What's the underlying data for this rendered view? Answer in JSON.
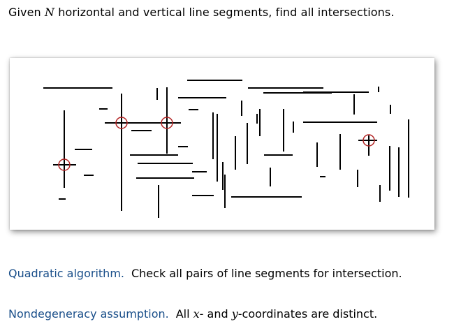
{
  "title": {
    "prefix": "Given",
    "var": "N",
    "suffix": "horizontal and vertical line segments, find all intersections."
  },
  "points": [
    {
      "term": "Quadratic algorithm.",
      "text_parts": [
        {
          "t": "Check all pairs of line segments for intersection.",
          "var": false
        }
      ]
    },
    {
      "term": "Nondegeneracy assumption.",
      "text_parts": [
        {
          "t": "All ",
          "var": false
        },
        {
          "t": "x",
          "var": true
        },
        {
          "t": "- and ",
          "var": false
        },
        {
          "t": "y",
          "var": true
        },
        {
          "t": "-coordinates are distinct.",
          "var": false
        }
      ]
    }
  ],
  "colors": {
    "segment": "#000000",
    "intersection_marker": "#b22222",
    "term": "#1a4f8a"
  }
}
